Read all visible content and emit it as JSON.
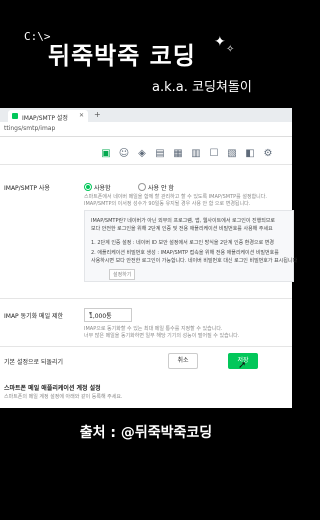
{
  "banner": {
    "cd_tag": "C:\\>",
    "title": "뒤죽박죽 코딩",
    "subtitle": "a.k.a. 코딩쳐돌이"
  },
  "browser": {
    "tab_title": "IMAP/SMTP 설정",
    "new_tab": "+",
    "url": "ttings/smtp/imap"
  },
  "settings": {
    "imap_label": "IMAP/SMTP 사용",
    "radio_on_label": "사용함",
    "radio_off_label": "사용 안 함",
    "desc_line1": "스마트폰에서 네이버 메일을 함께 할 관리하고 할 수 있도록 IMAP/SMTP를 설정합니다.",
    "desc_line2": "IMAP/SMTP의 이서정 성수가 90일동 유지될 경우 사용 안 함 으로 변경됩니다.",
    "info_line1": "IMAP/SMTP란? 네이버가 아닌 외부의 프로그램, 앱, 웹사이트에서 로그인이 진행되므로",
    "info_line2": "보다 안전한 로그인을 위해 2단계 인증 및 전용 애플리케이션 비밀번호를 사용해 주세요",
    "info_line3": "1. 2단계 인증 설정 : 네이버 ID 보안 설정에서 로그인 방식을 2단계 인증 환경으로 변경",
    "info_line4": "2. 애플리케이션 비밀번호 생성 : IMAP/SMTP 접속을 위해 전용 애플리케이션 비밀번호를",
    "info_line5": "사용하시면 보다 안전한 로그인이 가능합니다. 네이버 비밀번호 대신 로그인 비밀번호가 표시됩니다",
    "info_button": "설정하기",
    "sync_label": "IMAP 동기화 메일 제한",
    "sync_value": "1,000통",
    "sync_note1": "IMAP으로 동기화할 수 있는 최대 메일 통수를 지정할 수 있습니다.",
    "sync_note2": "너무 많은 메일을 동기화하면 일부 해당 기기의 성능이 떨어질 수 있습니다.",
    "reset_label": "기본 설정으로 되돌리기",
    "cancel_button": "취소",
    "save_button": "저장",
    "smart_title": "스마트폰 메일 애플리케이션 계정 설정",
    "smart_note": "스마트폰의 메일 계정 설정에 아래와 같이 등록해 주세요."
  },
  "footer": {
    "source": "출처 : @뒤죽박죽코딩"
  },
  "icons": [
    "mail-settings-icon",
    "contact-icon",
    "shield-icon",
    "keyboard-icon",
    "calendar-icon",
    "save-icon",
    "inbox-icon",
    "filter-icon",
    "tag-icon",
    "settings-icon"
  ],
  "colors": {
    "accent": "#03c75a"
  }
}
